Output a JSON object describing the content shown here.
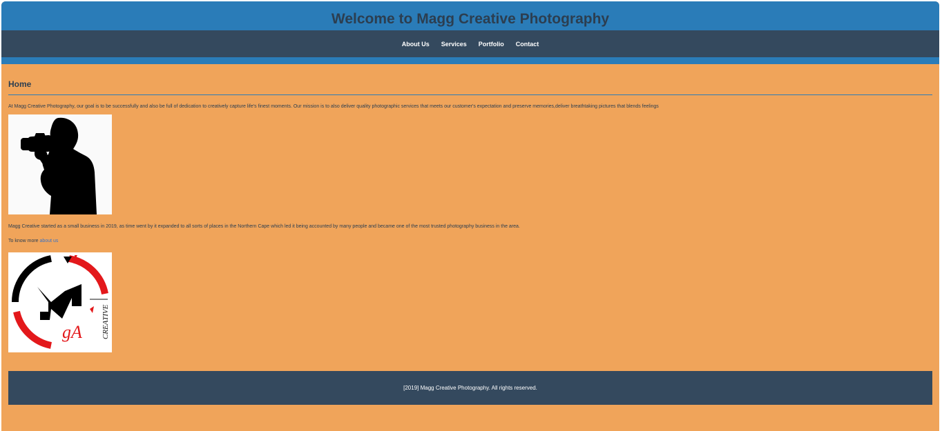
{
  "header": {
    "title": "Welcome to Magg Creative Photography"
  },
  "nav": {
    "items": [
      "About Us",
      "Services",
      "Portfolio",
      "Contact"
    ]
  },
  "main": {
    "section_title": "Home",
    "intro": "At Magg Creative Photography, our goal is to be successfully and also be full of dedication to creatively capture life's finest moments. Our mission is to also deliver quality photographic services that meets our customer's expectation and preserve memories,deliver breathtaking pictures that blends feelings",
    "history": "Magg Creative started as a small business in 2019, as time went by it expanded to all sorts of places in the Northern Cape which led it being accounted by many people and became one of the most trusted photography business in the area.",
    "know_more_prefix": "To know more ",
    "about_link": "about us",
    "logo_text": {
      "letters": "gA",
      "word": "CREATIVE"
    }
  },
  "footer": {
    "text": "[2019] Magg Creative Photography. All rights reserved."
  },
  "colors": {
    "page_background": "#f0a45a",
    "header_blue": "#2a7cb8",
    "nav_dark": "#34495e",
    "title_text": "#2c3e50",
    "link": "#3a73c6",
    "logo_red": "#e3181b"
  }
}
